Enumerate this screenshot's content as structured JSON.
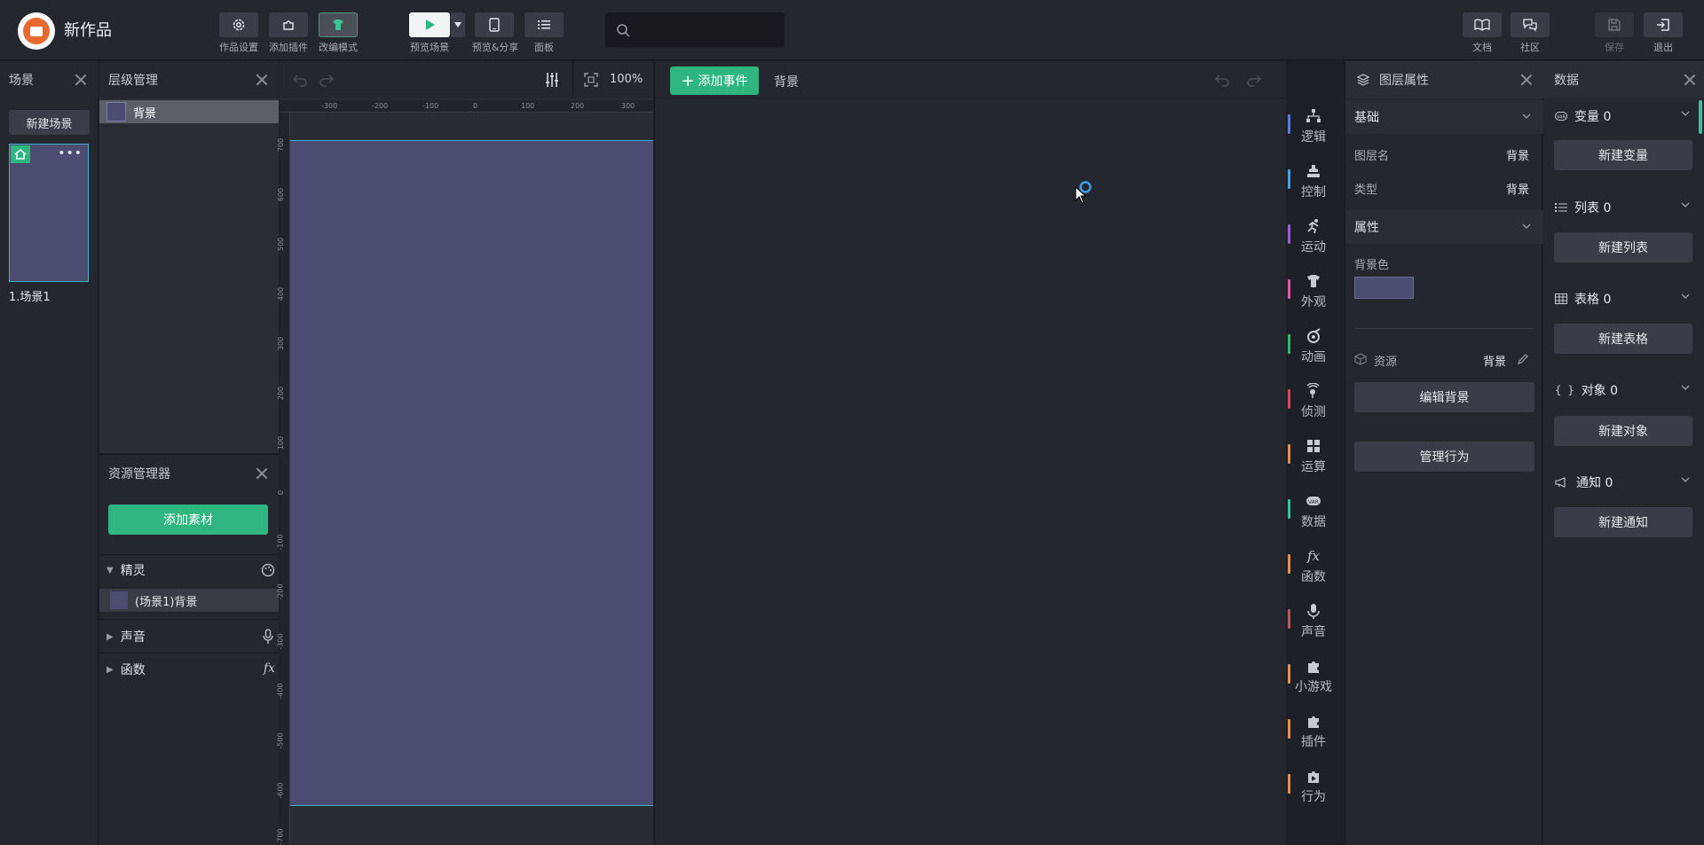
{
  "app": {
    "title": "新作品"
  },
  "toolbar": {
    "settings": "作品设置",
    "add_plugin": "添加插件",
    "edit_mode": "改编模式",
    "preview_scene": "预览场景",
    "preview_share": "预览&分享",
    "panel": "面板",
    "docs": "文档",
    "community": "社区",
    "save": "保存",
    "exit": "退出",
    "search_placeholder": ""
  },
  "scenes": {
    "title": "场景",
    "new_scene": "新建场景",
    "items": [
      {
        "label": "1.场景1"
      }
    ]
  },
  "layers": {
    "title": "层级管理",
    "items": [
      {
        "label": "背景"
      }
    ]
  },
  "assets": {
    "title": "资源管理器",
    "add_button": "添加素材",
    "groups": {
      "sprite": "精灵",
      "sound": "声音",
      "function": "函数"
    },
    "sprite_items": [
      {
        "label": "(场景1)背景"
      }
    ]
  },
  "canvas": {
    "zoom": "100%",
    "ruler_h": [
      "-300",
      "-200",
      "-100",
      "0",
      "100",
      "200",
      "300"
    ],
    "ruler_v": [
      "700",
      "600",
      "500",
      "400",
      "300",
      "200",
      "100",
      "0",
      "-100",
      "-200",
      "-300",
      "-400",
      "-500",
      "-600",
      "-700"
    ],
    "background_color": "#4b4c72"
  },
  "events": {
    "add_event": "添加事件",
    "current_target": "背景"
  },
  "categories": [
    {
      "label": "逻辑",
      "color": "#5b7bd6",
      "icon": "logic-icon"
    },
    {
      "label": "控制",
      "color": "#4aa0e6",
      "icon": "control-icon"
    },
    {
      "label": "运动",
      "color": "#9a5cd6",
      "icon": "run-icon"
    },
    {
      "label": "外观",
      "color": "#d65ca6",
      "icon": "shirt-icon"
    },
    {
      "label": "动画",
      "color": "#35b56a",
      "icon": "animation-icon"
    },
    {
      "label": "侦测",
      "color": "#d6455a",
      "icon": "detect-icon"
    },
    {
      "label": "运算",
      "color": "#e0904a",
      "icon": "grid-icon"
    },
    {
      "label": "数据",
      "color": "#3cbf9c",
      "icon": "var-icon"
    },
    {
      "label": "函数",
      "color": "#e0904a",
      "icon": "fx-icon"
    },
    {
      "label": "声音",
      "color": "#b55a5a",
      "icon": "mic-icon"
    },
    {
      "label": "小游戏",
      "color": "#e0904a",
      "icon": "puzzle-icon"
    },
    {
      "label": "插件",
      "color": "#e0904a",
      "icon": "puzzle-icon"
    },
    {
      "label": "行为",
      "color": "#e0904a",
      "icon": "puzzle-play-icon"
    }
  ],
  "layer_props": {
    "title": "图层属性",
    "basic": "基础",
    "layer_name_label": "图层名",
    "layer_name_value": "背景",
    "type_label": "类型",
    "type_value": "背景",
    "attrs": "属性",
    "bg_color_label": "背景色",
    "bg_color": "#4b4c72",
    "resource_label": "资源",
    "resource_value": "背景",
    "edit_bg": "编辑背景",
    "manage_behavior": "管理行为"
  },
  "data_panel": {
    "title": "数据",
    "sections": [
      {
        "label": "变量 0",
        "button": "新建变量",
        "icon": "var-icon"
      },
      {
        "label": "列表 0",
        "button": "新建列表",
        "icon": "list-icon"
      },
      {
        "label": "表格 0",
        "button": "新建表格",
        "icon": "table-icon"
      },
      {
        "label": "对象 0",
        "button": "新建对象",
        "icon": "braces-icon"
      },
      {
        "label": "通知 0",
        "button": "新建通知",
        "icon": "megaphone-icon"
      }
    ]
  }
}
